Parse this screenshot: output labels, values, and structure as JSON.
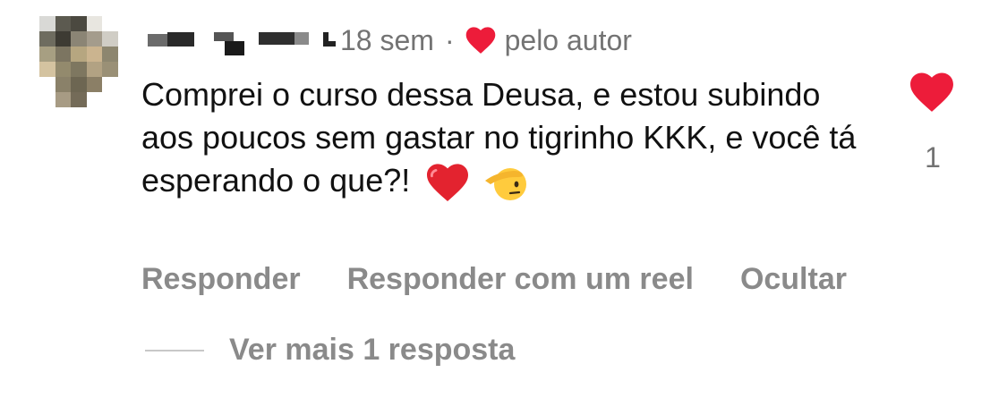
{
  "comment": {
    "time_ago": "18 sem",
    "separator": "·",
    "liked_by_author_label": "pelo autor",
    "text": "Comprei o curso dessa Deusa, e estou subindo aos poucos sem gastar no tigrinho KKK, e você tá esperando o que?!",
    "emojis": [
      "red-heart-emoji",
      "saluting-face-emoji"
    ],
    "like_count": "1",
    "like_color": "#ed1c3a"
  },
  "actions": {
    "reply": "Responder",
    "reply_with_reel": "Responder com um reel",
    "hide": "Ocultar"
  },
  "replies": {
    "view_more": "Ver mais 1 resposta"
  }
}
